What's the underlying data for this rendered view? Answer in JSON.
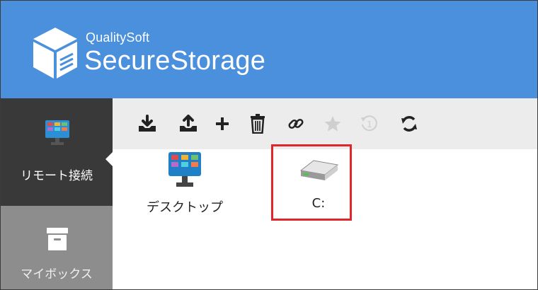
{
  "header": {
    "brand_small": "QualitySoft",
    "brand_name": "SecureStorage",
    "background": "#4a90dc"
  },
  "sidebar": {
    "items": [
      {
        "label": "リモート接続",
        "icon": "monitor-icon",
        "active": true
      },
      {
        "label": "マイボックス",
        "icon": "box-icon",
        "active": false
      }
    ]
  },
  "toolbar": {
    "buttons": [
      {
        "icon": "download-icon"
      },
      {
        "icon": "upload-icon"
      },
      {
        "icon": "plus-icon"
      },
      {
        "icon": "trash-icon"
      },
      {
        "icon": "link-icon"
      },
      {
        "icon": "star-icon"
      },
      {
        "icon": "history-icon",
        "text": "1"
      },
      {
        "icon": "refresh-icon"
      }
    ]
  },
  "files": [
    {
      "label": "デスクトップ",
      "icon": "desktop-icon"
    },
    {
      "label": "C:",
      "icon": "drive-icon"
    }
  ],
  "colors": {
    "accent": "#4a90dc",
    "highlight": "#e0262b"
  }
}
